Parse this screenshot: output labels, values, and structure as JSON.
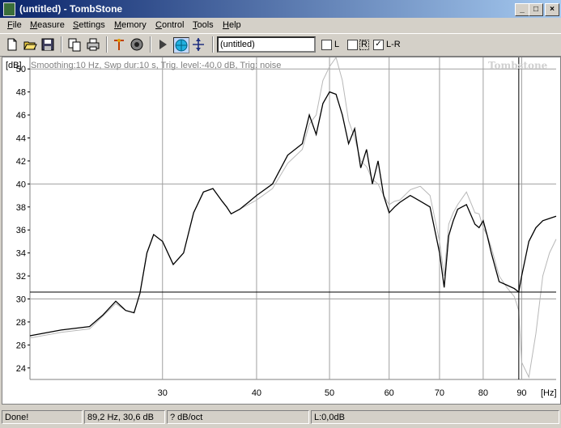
{
  "window": {
    "title": "(untitled) - TombStone",
    "minimize": "_",
    "maximize": "□",
    "close": "×"
  },
  "menu": [
    {
      "label": "File",
      "u": "F",
      "rest": "ile"
    },
    {
      "label": "Measure",
      "u": "M",
      "rest": "easure"
    },
    {
      "label": "Settings",
      "u": "S",
      "rest": "ettings"
    },
    {
      "label": "Memory",
      "u": "M",
      "rest": "emory"
    },
    {
      "label": "Control",
      "u": "C",
      "rest": "ontrol"
    },
    {
      "label": "Tools",
      "u": "T",
      "rest": "ools"
    },
    {
      "label": "Help",
      "u": "H",
      "rest": "elp"
    }
  ],
  "toolbar": {
    "icons": [
      "new-file-icon",
      "open-folder-icon",
      "save-icon",
      "copy-icon",
      "print-icon",
      "antenna-icon",
      "speaker-icon",
      "play-icon",
      "globe-icon",
      "move-arrows-icon"
    ],
    "name_value": "(untitled)",
    "checkboxes": [
      {
        "label": "L",
        "checked": false
      },
      {
        "label": "R",
        "checked": false
      },
      {
        "label": "L-R",
        "checked": true
      }
    ]
  },
  "plot": {
    "info": "Smoothing:10 Hz, Swp dur:10 s, Trig. level:-40,0 dB, Trig: noise",
    "watermark": "Tombstone",
    "y_unit": "[dB]",
    "x_unit": "[Hz]"
  },
  "chart_data": {
    "type": "line",
    "x_scale": "log",
    "xlim": [
      20,
      100
    ],
    "ylim": [
      23,
      51
    ],
    "x_ticks": [
      30,
      40,
      50,
      60,
      70,
      80,
      90
    ],
    "y_ticks": [
      24,
      26,
      28,
      30,
      32,
      34,
      36,
      38,
      40,
      42,
      44,
      46,
      48,
      50
    ],
    "cursor": {
      "x": 89.2,
      "y": 30.6
    },
    "series": [
      {
        "color": "#000000",
        "x": [
          20,
          22,
          24,
          25,
          26,
          26.8,
          27.5,
          28,
          28.6,
          29.2,
          30,
          31,
          32,
          33,
          34,
          35,
          36,
          36.5,
          37,
          38,
          39,
          40,
          42,
          44,
          46,
          47,
          48,
          49,
          50,
          51,
          52,
          53,
          54,
          55,
          56,
          57,
          58,
          59,
          60,
          61,
          62,
          64,
          66,
          68,
          70,
          71,
          72,
          73,
          74,
          76,
          78,
          79,
          80,
          81,
          82,
          84,
          86,
          88,
          89.2,
          90,
          92,
          94,
          96,
          98,
          100
        ],
        "y": [
          26.8,
          27.3,
          27.6,
          28.6,
          29.8,
          29,
          28.8,
          30.5,
          34,
          35.6,
          35,
          33,
          34,
          37.5,
          39.3,
          39.6,
          38.5,
          38,
          37.4,
          37.8,
          38.4,
          39,
          40,
          42.5,
          43.5,
          46,
          44.3,
          47,
          48,
          47.8,
          46,
          43.5,
          44.8,
          41.4,
          43,
          40,
          42,
          39,
          37.5,
          38,
          38.4,
          39,
          38.5,
          38,
          34,
          31,
          35.5,
          36.8,
          37.8,
          38.2,
          36.5,
          36.2,
          36.8,
          35.5,
          34,
          31.5,
          31.2,
          30.9,
          30.6,
          32,
          35,
          36.2,
          36.8,
          37,
          37.2
        ]
      },
      {
        "color": "#b8b8b8",
        "x": [
          20,
          22,
          24,
          25,
          26,
          26.8,
          27.5,
          28,
          28.6,
          29.2,
          30,
          31,
          32,
          33,
          34,
          35,
          36,
          36.5,
          37,
          38,
          39,
          40,
          42,
          44,
          46,
          47,
          48,
          49,
          50,
          51,
          52,
          53,
          54,
          55,
          56,
          57,
          58,
          59,
          60,
          61,
          62,
          64,
          66,
          68,
          70,
          71,
          72,
          73,
          74,
          76,
          78,
          79,
          80,
          81,
          82,
          84,
          86,
          88,
          89.2,
          90,
          92,
          94,
          96,
          98,
          100
        ],
        "y": [
          26.6,
          27.1,
          27.4,
          28.5,
          29.6,
          29,
          28.8,
          30.5,
          34,
          35.6,
          35,
          33,
          34,
          37.5,
          39.3,
          39.6,
          38.5,
          38,
          37.4,
          37.8,
          38.2,
          38.6,
          39.6,
          41.8,
          43,
          45.2,
          46,
          49,
          50.2,
          51,
          49,
          45.5,
          44,
          42,
          41.5,
          40.4,
          40,
          39,
          38.2,
          38.5,
          38.6,
          39.5,
          39.8,
          39,
          35,
          32,
          36.5,
          37.5,
          38.2,
          39.3,
          37.5,
          37.4,
          36.2,
          35.5,
          34.5,
          32,
          31,
          30.2,
          29,
          24.5,
          23.2,
          27,
          32,
          34,
          35.2
        ]
      }
    ]
  },
  "status": {
    "message": "Done!",
    "cursor_readout": "89,2 Hz, 30,6 dB",
    "slope": "? dB/oct",
    "level": "L:0,0dB"
  }
}
